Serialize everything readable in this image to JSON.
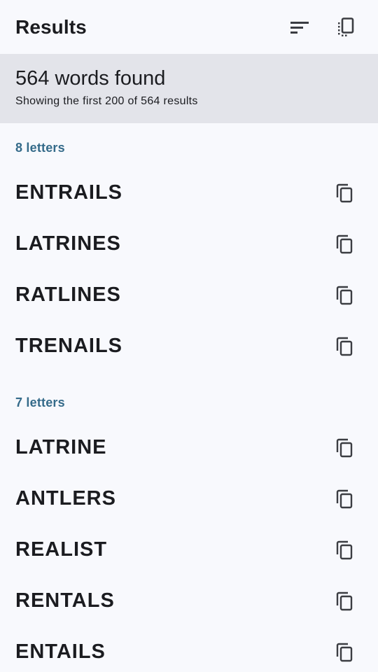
{
  "header": {
    "title": "Results",
    "sort_icon": "sort-icon",
    "copy_all_icon": "copy-all-icon"
  },
  "summary": {
    "count_text": "564 words found",
    "subtitle": "Showing the first 200 of 564 results"
  },
  "sections": [
    {
      "header": "8 letters",
      "words": [
        "ENTRAILS",
        "LATRINES",
        "RATLINES",
        "TRENAILS"
      ]
    },
    {
      "header": "7 letters",
      "words": [
        "LATRINE",
        "ANTLERS",
        "REALIST",
        "RENTALS",
        "ENTAILS"
      ]
    }
  ],
  "colors": {
    "background": "#f8f9fd",
    "summary_background": "#e3e4ea",
    "section_header": "#356b8a",
    "text": "#1b1c20",
    "icon": "#3b3d42"
  }
}
